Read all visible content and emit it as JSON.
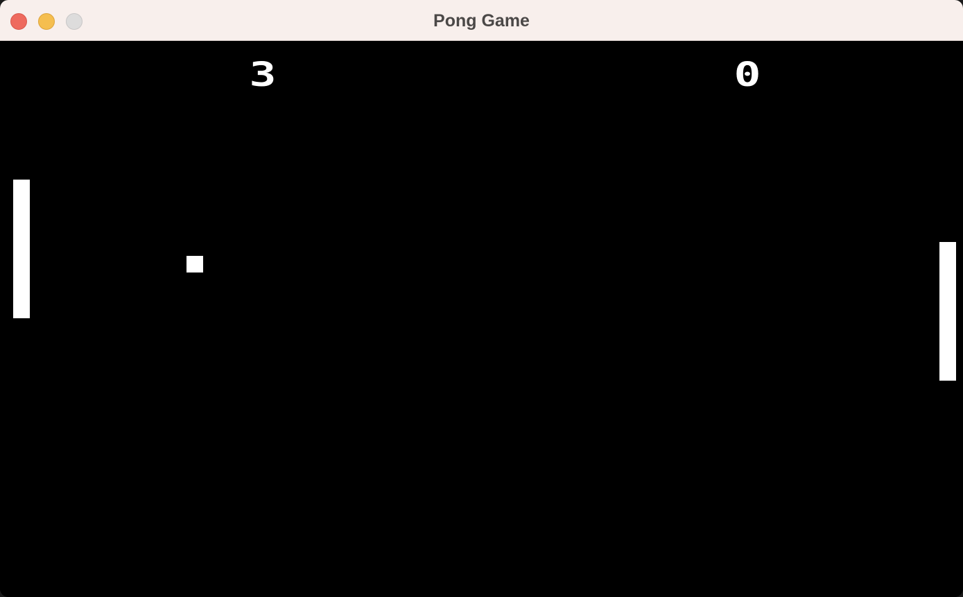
{
  "window": {
    "title": "Pong Game"
  },
  "colors": {
    "titlebar_bg": "#f8efec",
    "playfield_bg": "#000000",
    "foreground": "#ffffff",
    "close": "#ee6a5e",
    "minimize": "#f5be4f",
    "zoom": "#dddcdc"
  },
  "game": {
    "score_left": "3",
    "score_right": "0"
  }
}
